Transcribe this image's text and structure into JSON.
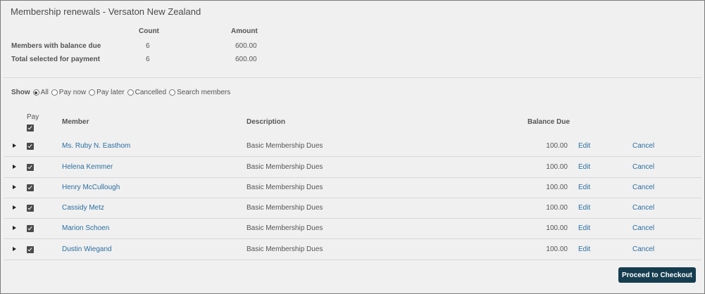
{
  "title": "Membership renewals - Versaton New Zealand",
  "summary": {
    "count_header": "Count",
    "amount_header": "Amount",
    "rows": [
      {
        "label": "Members with balance due",
        "count": "6",
        "amount": "600.00"
      },
      {
        "label": "Total selected for payment",
        "count": "6",
        "amount": "600.00"
      }
    ]
  },
  "filter": {
    "label": "Show",
    "options": [
      {
        "label": "All",
        "selected": true
      },
      {
        "label": "Pay now",
        "selected": false
      },
      {
        "label": "Pay later",
        "selected": false
      },
      {
        "label": "Cancelled",
        "selected": false
      },
      {
        "label": "Search members",
        "selected": false
      }
    ]
  },
  "table": {
    "headers": {
      "pay": "Pay",
      "member": "Member",
      "description": "Description",
      "balance": "Balance Due"
    },
    "rows": [
      {
        "member": "Ms. Ruby N. Easthom",
        "description": "Basic Membership Dues",
        "balance": "100.00",
        "edit": "Edit",
        "cancel": "Cancel",
        "checked": true
      },
      {
        "member": "Helena Kemmer",
        "description": "Basic Membership Dues",
        "balance": "100.00",
        "edit": "Edit",
        "cancel": "Cancel",
        "checked": true
      },
      {
        "member": "Henry McCullough",
        "description": "Basic Membership Dues",
        "balance": "100.00",
        "edit": "Edit",
        "cancel": "Cancel",
        "checked": true
      },
      {
        "member": "Cassidy Metz",
        "description": "Basic Membership Dues",
        "balance": "100.00",
        "edit": "Edit",
        "cancel": "Cancel",
        "checked": true
      },
      {
        "member": "Marion Schoen",
        "description": "Basic Membership Dues",
        "balance": "100.00",
        "edit": "Edit",
        "cancel": "Cancel",
        "checked": true
      },
      {
        "member": "Dustin Wiegand",
        "description": "Basic Membership Dues",
        "balance": "100.00",
        "edit": "Edit",
        "cancel": "Cancel",
        "checked": true
      }
    ]
  },
  "checkout_label": "Proceed to Checkout"
}
